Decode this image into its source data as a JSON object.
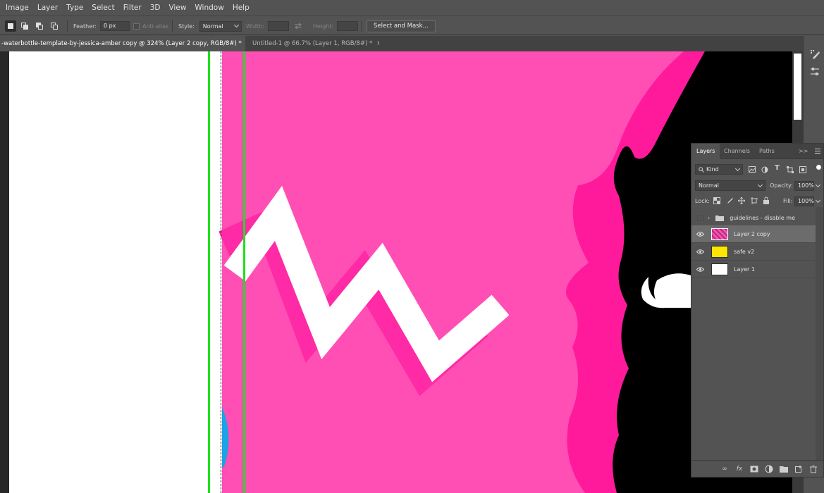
{
  "menu": [
    "Image",
    "Layer",
    "Type",
    "Select",
    "Filter",
    "3D",
    "View",
    "Window",
    "Help"
  ],
  "options": {
    "feather_label": "Feather:",
    "feather_value": "0 px",
    "antialias_label": "Anti-alias",
    "style_label": "Style:",
    "style_value": "Normal",
    "width_label": "Width:",
    "height_label": "Height:",
    "select_mask_label": "Select and Mask..."
  },
  "tabs": [
    {
      "title": "-waterbottle-template-by-jessica-amber copy @ 324% (Layer 2 copy, RGB/8#) *",
      "close": "×",
      "active": true
    },
    {
      "title": "Untitled-1 @ 66.7% (Layer 1, RGB/8#) *",
      "close": "×",
      "active": false
    }
  ],
  "layers_panel": {
    "tabs": [
      "Layers",
      "Channels",
      "Paths"
    ],
    "menu_glyph": ">>",
    "filter_kind": "Kind",
    "blend_mode": "Normal",
    "opacity_label": "Opacity:",
    "opacity_value": "100%",
    "lock_label": "Lock:",
    "fill_label": "Fill:",
    "fill_value": "100%",
    "layers": [
      {
        "name": "guidelines - disable me",
        "type": "group",
        "visible": false,
        "selected": false
      },
      {
        "name": "Layer 2 copy",
        "type": "layer",
        "visible": true,
        "selected": true,
        "thumb_color": "#ff4fb4"
      },
      {
        "name": "safe v2",
        "type": "layer",
        "visible": true,
        "selected": false,
        "thumb_color": "#ffe600"
      },
      {
        "name": "Layer 1",
        "type": "layer",
        "visible": true,
        "selected": false,
        "thumb_color": "#ffffff"
      }
    ]
  },
  "colors": {
    "canvas_pink": "#ff4fb4",
    "deep_pink": "#ff1a9c",
    "guide_green": "#1ee11e",
    "selection_row": "#6c6c6c"
  }
}
